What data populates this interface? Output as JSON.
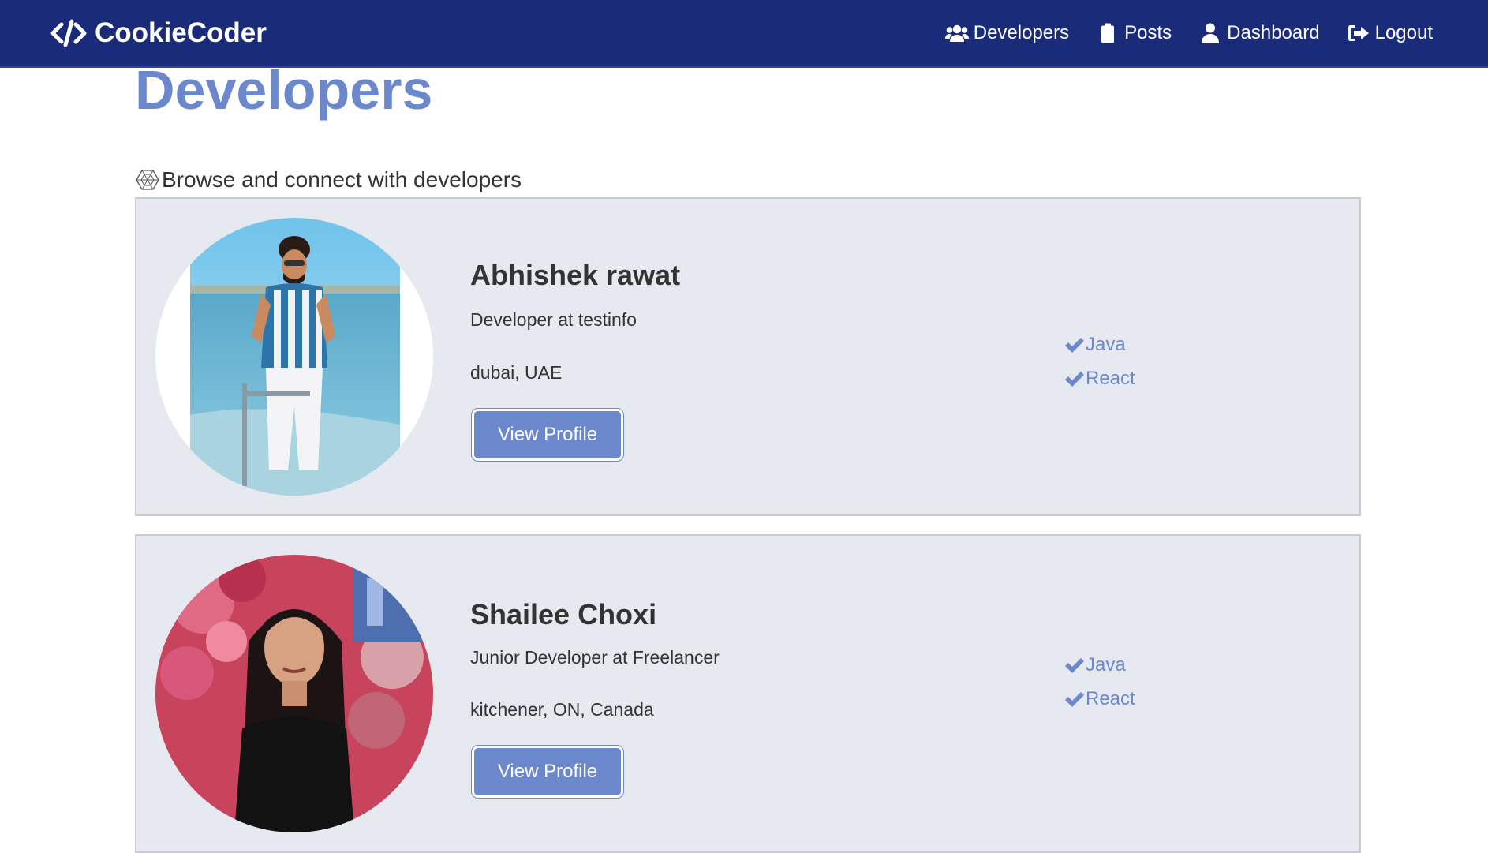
{
  "navbar": {
    "brand": "CookieCoder",
    "links": [
      {
        "label": "Developers",
        "icon": "users-icon"
      },
      {
        "label": "Posts",
        "icon": "clipboard-icon"
      },
      {
        "label": "Dashboard",
        "icon": "user-icon"
      },
      {
        "label": "Logout",
        "icon": "sign-out-icon"
      }
    ]
  },
  "page": {
    "title": "Developers",
    "lead": "Browse and connect with developers",
    "lead_icon": "connectdevelop-icon"
  },
  "profiles": [
    {
      "name": "Abhishek rawat",
      "status": "Developer at testinfo",
      "location": "dubai, UAE",
      "button": "View Profile",
      "skills": [
        "Java",
        "React"
      ]
    },
    {
      "name": "Shailee Choxi",
      "status": "Junior Developer at Freelancer",
      "location": "kitchener, ON, Canada",
      "button": "View Profile",
      "skills": [
        "Java",
        "React"
      ]
    }
  ],
  "colors": {
    "navbar_bg": "#1a2b7a",
    "accent": "#6b88cc",
    "card_bg": "#e6e9f0",
    "text": "#333333"
  }
}
